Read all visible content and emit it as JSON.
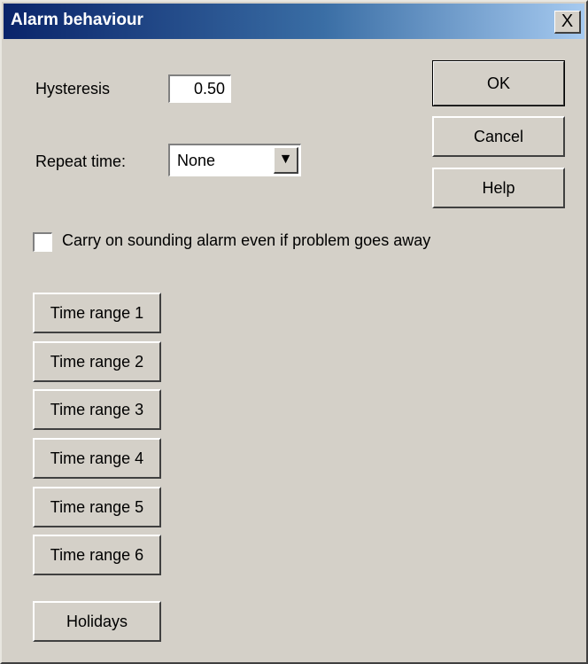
{
  "window": {
    "title": "Alarm behaviour",
    "close_glyph": "X"
  },
  "hysteresis": {
    "label": "Hysteresis",
    "value": "0.50"
  },
  "repeat_time": {
    "label": "Repeat time:",
    "selected": "None",
    "arrow_icon": "triangle-down-icon"
  },
  "buttons": {
    "ok": "OK",
    "cancel": "Cancel",
    "help": "Help"
  },
  "checkbox": {
    "label": "Carry on sounding alarm even if problem goes away",
    "checked": false
  },
  "time_ranges": [
    "Time range 1",
    "Time range 2",
    "Time range 3",
    "Time range 4",
    "Time range 5",
    "Time range 6"
  ],
  "holidays": "Holidays"
}
